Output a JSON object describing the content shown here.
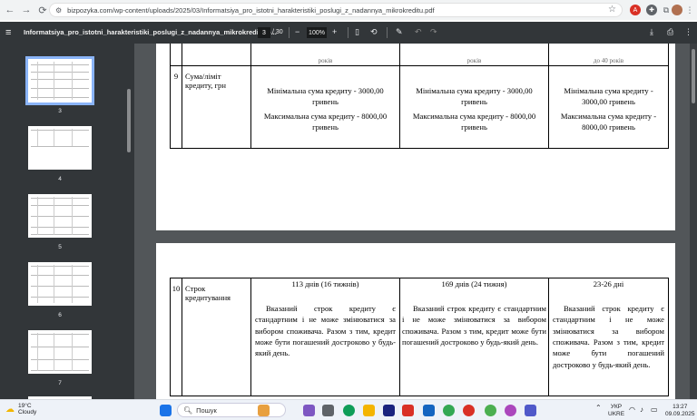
{
  "browser": {
    "url": "bizpozyka.com/wp-content/uploads/2025/03/Informatsiya_pro_istotni_harakteristiki_poslugi_z_nadannya_mikrokreditu.pdf",
    "back_icon": "arrow-left-icon",
    "forward_icon": "arrow-right-icon",
    "reload_icon": "reload-icon"
  },
  "pdf_toolbar": {
    "title": "Informatsiya_pro_istotni_harakteristiki_poslugi_z_nadannya_mikrokreditu.p...",
    "page_current": "3",
    "page_total": "/ 30",
    "zoom": "100%"
  },
  "thumbnails": [
    {
      "label": "3",
      "selected": true
    },
    {
      "label": "4",
      "selected": false
    },
    {
      "label": "5",
      "selected": false
    },
    {
      "label": "6",
      "selected": false
    },
    {
      "label": "7",
      "selected": false
    }
  ],
  "document": {
    "top_header_fragments": [
      "років",
      "років",
      "до 40 років"
    ],
    "row9": {
      "num": "9",
      "name": "Сума/ліміт кредиту, грн",
      "col1_min": "Мінімальна сума кредиту - 3000,00 гривень",
      "col1_max": "Максимальна сума кредиту - 8000,00 гривень",
      "col2_min": "Мінімальна сума кредиту - 3000,00 гривень",
      "col2_max": "Максимальна сума кредиту - 8000,00 гривень",
      "col3_min": "Мінімальна сума кредиту - 3000,00 гривень",
      "col3_max": "Максимальна сума кредиту - 8000,00 гривень"
    },
    "row10": {
      "num": "10",
      "name": "Строк кредитування",
      "col1_title": "113 днів (16 тижнів)",
      "col2_title": "169 днів (24 тижня)",
      "col3_title": "23-26 дні",
      "body": "Вказаний строк кредиту є стандартним і не може змінюватися за вибором споживача. Разом з тим, кредит може бути погашений достроково у будь-який день."
    }
  },
  "taskbar": {
    "temperature": "19°C",
    "weather": "Cloudy",
    "search_placeholder": "Пошук",
    "lang1": "УКР",
    "lang2": "UKRE",
    "time": "13:27",
    "date": "09.09.2025"
  }
}
